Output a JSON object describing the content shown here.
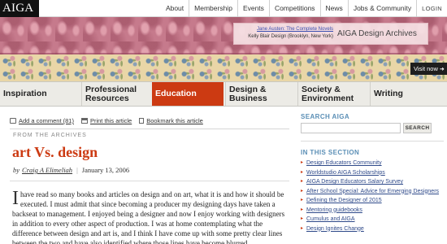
{
  "logo": {
    "text": "AIGA"
  },
  "top_nav": [
    "About",
    "Membership",
    "Events",
    "Competitions",
    "News",
    "Jobs & Community",
    "LOGIN"
  ],
  "banner": {
    "caption_link": "Jane Austen: The Complete Novels",
    "caption_credit": "Kelly Blair Design (Brooklyn, New York)",
    "archive_label": "AIGA Design Archives",
    "visit_label": "Visit now",
    "colors": {
      "damask": "#c67a8c",
      "floral": "#e9d6a7"
    }
  },
  "main_nav": [
    {
      "label": "Inspiration"
    },
    {
      "label": "Professional Resources"
    },
    {
      "label": "Education",
      "active": true
    },
    {
      "label": "Design & Business"
    },
    {
      "label": "Society & Environment"
    },
    {
      "label": "Writing"
    }
  ],
  "article_tools": {
    "comment": "Add a comment (81)",
    "print": "Print this article",
    "bookmark": "Bookmark this article"
  },
  "kicker": "FROM THE ARCHIVES",
  "article": {
    "title": "art Vs. design",
    "by": "by",
    "author": "Craig A Elimeliah",
    "date": "January 13, 2006",
    "drop_cap": "I",
    "body": " have read so many books and articles on design and on art, what it is and how it should be executed. I must admit that since becoming a producer my designing days have taken a backseat to management. I enjoyed being a designer and now I enjoy working with designers in addition to every other aspect of production. I was at home contemplating what the difference between design and art is, and I think I have come up with some pretty clear lines between the two and have also identified where those lines have become blurred."
  },
  "sidebar": {
    "search_heading": "SEARCH AIGA",
    "search_value": "",
    "search_button": "SEARCH",
    "section_heading": "IN THIS SECTION",
    "section_links": [
      "Design Educators Community",
      "Worldstudio AIGA Scholarships",
      "AIGA Design Educators Salary Survey",
      "After School Special: Advice for Emerging Designers",
      "Defining the Designer of 2015",
      "Mentoring guidebooks",
      "Cumulus and AIGA",
      "Design Ignites Change"
    ]
  },
  "colors": {
    "accent": "#cc3a12",
    "link": "#2f4a8a",
    "heading_blue": "#5b8fb6"
  }
}
